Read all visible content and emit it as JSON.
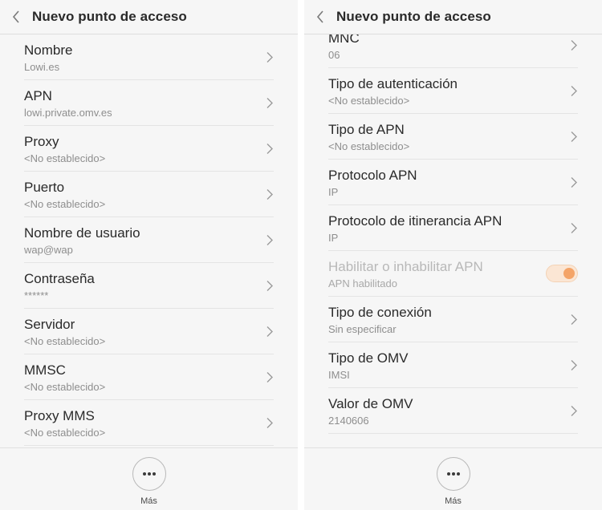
{
  "left": {
    "header": {
      "title": "Nuevo punto de acceso"
    },
    "items": [
      {
        "title": "Nombre",
        "value": "Lowi.es"
      },
      {
        "title": "APN",
        "value": "lowi.private.omv.es"
      },
      {
        "title": "Proxy",
        "value": "<No establecido>"
      },
      {
        "title": "Puerto",
        "value": "<No establecido>"
      },
      {
        "title": "Nombre de usuario",
        "value": "wap@wap"
      },
      {
        "title": "Contraseña",
        "value": "******"
      },
      {
        "title": "Servidor",
        "value": "<No establecido>"
      },
      {
        "title": "MMSC",
        "value": "<No establecido>"
      },
      {
        "title": "Proxy MMS",
        "value": "<No establecido>"
      }
    ],
    "bottom": {
      "more_label": "Más"
    }
  },
  "right": {
    "header": {
      "title": "Nuevo punto de acceso"
    },
    "items": [
      {
        "title": "MNC",
        "value": "06"
      },
      {
        "title": "Tipo de autenticación",
        "value": "<No establecido>"
      },
      {
        "title": "Tipo de APN",
        "value": "<No establecido>"
      },
      {
        "title": "Protocolo APN",
        "value": "IP"
      },
      {
        "title": "Protocolo de itinerancia APN",
        "value": "IP"
      },
      {
        "title": "Habilitar o inhabilitar APN",
        "value": "APN habilitado",
        "toggle_on": true
      },
      {
        "title": "Tipo de conexión",
        "value": "Sin especificar"
      },
      {
        "title": "Tipo de OMV",
        "value": "IMSI"
      },
      {
        "title": "Valor de OMV",
        "value": "2140606"
      }
    ],
    "bottom": {
      "more_label": "Más"
    }
  },
  "colors": {
    "accent": "#f4a468",
    "text": "#2a2a2a",
    "subtext": "#8e8e8e",
    "background": "#f6f6f6"
  }
}
